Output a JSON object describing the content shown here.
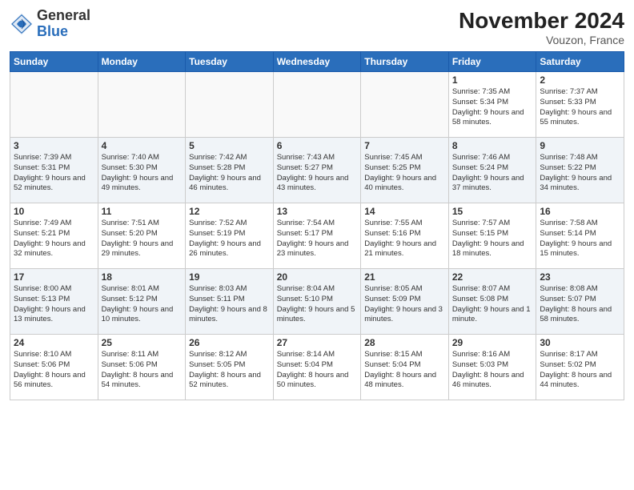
{
  "header": {
    "logo_general": "General",
    "logo_blue": "Blue",
    "month_year": "November 2024",
    "location": "Vouzon, France"
  },
  "days_of_week": [
    "Sunday",
    "Monday",
    "Tuesday",
    "Wednesday",
    "Thursday",
    "Friday",
    "Saturday"
  ],
  "weeks": [
    {
      "days": [
        {
          "num": "",
          "info": ""
        },
        {
          "num": "",
          "info": ""
        },
        {
          "num": "",
          "info": ""
        },
        {
          "num": "",
          "info": ""
        },
        {
          "num": "",
          "info": ""
        },
        {
          "num": "1",
          "info": "Sunrise: 7:35 AM\nSunset: 5:34 PM\nDaylight: 9 hours\nand 58 minutes."
        },
        {
          "num": "2",
          "info": "Sunrise: 7:37 AM\nSunset: 5:33 PM\nDaylight: 9 hours\nand 55 minutes."
        }
      ]
    },
    {
      "days": [
        {
          "num": "3",
          "info": "Sunrise: 7:39 AM\nSunset: 5:31 PM\nDaylight: 9 hours\nand 52 minutes."
        },
        {
          "num": "4",
          "info": "Sunrise: 7:40 AM\nSunset: 5:30 PM\nDaylight: 9 hours\nand 49 minutes."
        },
        {
          "num": "5",
          "info": "Sunrise: 7:42 AM\nSunset: 5:28 PM\nDaylight: 9 hours\nand 46 minutes."
        },
        {
          "num": "6",
          "info": "Sunrise: 7:43 AM\nSunset: 5:27 PM\nDaylight: 9 hours\nand 43 minutes."
        },
        {
          "num": "7",
          "info": "Sunrise: 7:45 AM\nSunset: 5:25 PM\nDaylight: 9 hours\nand 40 minutes."
        },
        {
          "num": "8",
          "info": "Sunrise: 7:46 AM\nSunset: 5:24 PM\nDaylight: 9 hours\nand 37 minutes."
        },
        {
          "num": "9",
          "info": "Sunrise: 7:48 AM\nSunset: 5:22 PM\nDaylight: 9 hours\nand 34 minutes."
        }
      ]
    },
    {
      "days": [
        {
          "num": "10",
          "info": "Sunrise: 7:49 AM\nSunset: 5:21 PM\nDaylight: 9 hours\nand 32 minutes."
        },
        {
          "num": "11",
          "info": "Sunrise: 7:51 AM\nSunset: 5:20 PM\nDaylight: 9 hours\nand 29 minutes."
        },
        {
          "num": "12",
          "info": "Sunrise: 7:52 AM\nSunset: 5:19 PM\nDaylight: 9 hours\nand 26 minutes."
        },
        {
          "num": "13",
          "info": "Sunrise: 7:54 AM\nSunset: 5:17 PM\nDaylight: 9 hours\nand 23 minutes."
        },
        {
          "num": "14",
          "info": "Sunrise: 7:55 AM\nSunset: 5:16 PM\nDaylight: 9 hours\nand 21 minutes."
        },
        {
          "num": "15",
          "info": "Sunrise: 7:57 AM\nSunset: 5:15 PM\nDaylight: 9 hours\nand 18 minutes."
        },
        {
          "num": "16",
          "info": "Sunrise: 7:58 AM\nSunset: 5:14 PM\nDaylight: 9 hours\nand 15 minutes."
        }
      ]
    },
    {
      "days": [
        {
          "num": "17",
          "info": "Sunrise: 8:00 AM\nSunset: 5:13 PM\nDaylight: 9 hours\nand 13 minutes."
        },
        {
          "num": "18",
          "info": "Sunrise: 8:01 AM\nSunset: 5:12 PM\nDaylight: 9 hours\nand 10 minutes."
        },
        {
          "num": "19",
          "info": "Sunrise: 8:03 AM\nSunset: 5:11 PM\nDaylight: 9 hours\nand 8 minutes."
        },
        {
          "num": "20",
          "info": "Sunrise: 8:04 AM\nSunset: 5:10 PM\nDaylight: 9 hours\nand 5 minutes."
        },
        {
          "num": "21",
          "info": "Sunrise: 8:05 AM\nSunset: 5:09 PM\nDaylight: 9 hours\nand 3 minutes."
        },
        {
          "num": "22",
          "info": "Sunrise: 8:07 AM\nSunset: 5:08 PM\nDaylight: 9 hours\nand 1 minute."
        },
        {
          "num": "23",
          "info": "Sunrise: 8:08 AM\nSunset: 5:07 PM\nDaylight: 8 hours\nand 58 minutes."
        }
      ]
    },
    {
      "days": [
        {
          "num": "24",
          "info": "Sunrise: 8:10 AM\nSunset: 5:06 PM\nDaylight: 8 hours\nand 56 minutes."
        },
        {
          "num": "25",
          "info": "Sunrise: 8:11 AM\nSunset: 5:06 PM\nDaylight: 8 hours\nand 54 minutes."
        },
        {
          "num": "26",
          "info": "Sunrise: 8:12 AM\nSunset: 5:05 PM\nDaylight: 8 hours\nand 52 minutes."
        },
        {
          "num": "27",
          "info": "Sunrise: 8:14 AM\nSunset: 5:04 PM\nDaylight: 8 hours\nand 50 minutes."
        },
        {
          "num": "28",
          "info": "Sunrise: 8:15 AM\nSunset: 5:04 PM\nDaylight: 8 hours\nand 48 minutes."
        },
        {
          "num": "29",
          "info": "Sunrise: 8:16 AM\nSunset: 5:03 PM\nDaylight: 8 hours\nand 46 minutes."
        },
        {
          "num": "30",
          "info": "Sunrise: 8:17 AM\nSunset: 5:02 PM\nDaylight: 8 hours\nand 44 minutes."
        }
      ]
    }
  ]
}
